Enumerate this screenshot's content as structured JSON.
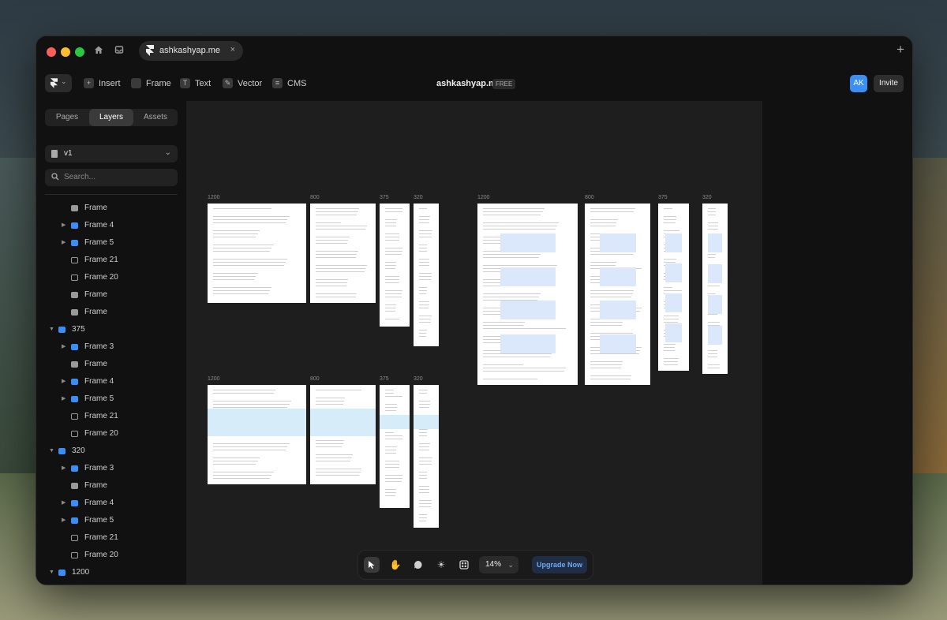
{
  "browser": {
    "tab_title": "ashkashyap.me",
    "close_glyph": "×",
    "new_tab_glyph": "+"
  },
  "toolbar": {
    "insert": "Insert",
    "frame": "Frame",
    "text": "Text",
    "vector": "Vector",
    "cms": "CMS",
    "project_title": "ashkashyap.me",
    "plan_badge": "FREE",
    "avatar_initials": "AK",
    "invite": "Invite"
  },
  "sidebar": {
    "tabs": [
      "Pages",
      "Layers",
      "Assets"
    ],
    "active_tab": "Layers",
    "page_select": "v1",
    "search_placeholder": "Search...",
    "layers": [
      {
        "label": "Frame",
        "icon": "frame-icon",
        "caret": false,
        "indent": 1
      },
      {
        "label": "Frame 4",
        "icon": "stack-icon",
        "caret": true,
        "indent": 1
      },
      {
        "label": "Frame 5",
        "icon": "stack-icon",
        "caret": true,
        "indent": 1
      },
      {
        "label": "Frame 21",
        "icon": "grid-icon",
        "caret": false,
        "indent": 1
      },
      {
        "label": "Frame 20",
        "icon": "grid-icon",
        "caret": false,
        "indent": 1
      },
      {
        "label": "Frame",
        "icon": "frame-icon",
        "caret": false,
        "indent": 1
      },
      {
        "label": "Frame",
        "icon": "frame-icon",
        "caret": false,
        "indent": 1
      },
      {
        "label": "375",
        "icon": "stack-icon",
        "caret": "down",
        "indent": 0
      },
      {
        "label": "Frame 3",
        "icon": "stack-icon",
        "caret": true,
        "indent": 1
      },
      {
        "label": "Frame",
        "icon": "frame-icon",
        "caret": false,
        "indent": 1
      },
      {
        "label": "Frame 4",
        "icon": "stack-icon",
        "caret": true,
        "indent": 1
      },
      {
        "label": "Frame 5",
        "icon": "stack-icon",
        "caret": true,
        "indent": 1
      },
      {
        "label": "Frame 21",
        "icon": "grid-icon",
        "caret": false,
        "indent": 1
      },
      {
        "label": "Frame 20",
        "icon": "grid-icon",
        "caret": false,
        "indent": 1
      },
      {
        "label": "320",
        "icon": "stack-icon",
        "caret": "down",
        "indent": 0
      },
      {
        "label": "Frame 3",
        "icon": "stack-icon",
        "caret": true,
        "indent": 1
      },
      {
        "label": "Frame",
        "icon": "frame-icon",
        "caret": false,
        "indent": 1
      },
      {
        "label": "Frame 4",
        "icon": "stack-icon",
        "caret": true,
        "indent": 1
      },
      {
        "label": "Frame 5",
        "icon": "stack-icon",
        "caret": true,
        "indent": 1
      },
      {
        "label": "Frame 21",
        "icon": "grid-icon",
        "caret": false,
        "indent": 1
      },
      {
        "label": "Frame 20",
        "icon": "grid-icon",
        "caret": false,
        "indent": 1
      },
      {
        "label": "1200",
        "icon": "stack-icon",
        "caret": "down",
        "indent": 0
      }
    ]
  },
  "canvas": {
    "frames": [
      {
        "label": "1200",
        "variant": "text"
      },
      {
        "label": "800",
        "variant": "text"
      },
      {
        "label": "375",
        "variant": "text"
      },
      {
        "label": "320",
        "variant": "text"
      },
      {
        "label": "1200",
        "variant": "blocks"
      },
      {
        "label": "800",
        "variant": "blocks"
      },
      {
        "label": "375",
        "variant": "blocks"
      },
      {
        "label": "320",
        "variant": "blocks"
      },
      {
        "label": "1200",
        "variant": "band"
      },
      {
        "label": "800",
        "variant": "band"
      },
      {
        "label": "375",
        "variant": "band"
      },
      {
        "label": "320",
        "variant": "band"
      }
    ]
  },
  "bottom_toolbar": {
    "tools": [
      "select-icon",
      "hand-icon",
      "comment-icon",
      "sun-icon",
      "components-icon"
    ],
    "zoom": "14%",
    "upgrade": "Upgrade Now"
  },
  "colors": {
    "accent": "#3a8ef6",
    "window_bg": "#111111",
    "canvas_bg": "#1e1e1e"
  }
}
